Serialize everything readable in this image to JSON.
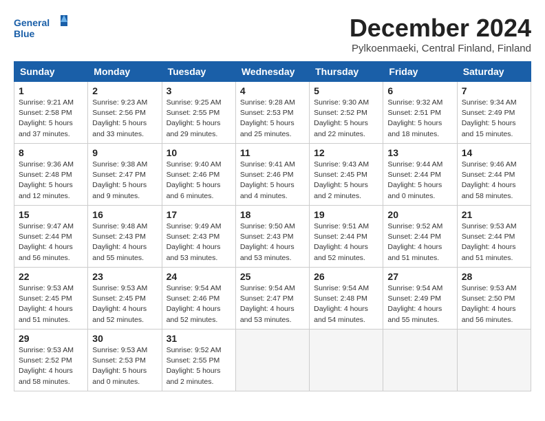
{
  "header": {
    "logo_general": "General",
    "logo_blue": "Blue",
    "month_title": "December 2024",
    "location": "Pylkoenmaeki, Central Finland, Finland"
  },
  "columns": [
    "Sunday",
    "Monday",
    "Tuesday",
    "Wednesday",
    "Thursday",
    "Friday",
    "Saturday"
  ],
  "weeks": [
    [
      {
        "day": "1",
        "sr": "9:21 AM",
        "ss": "2:58 PM",
        "dl": "5 hours and 37 minutes."
      },
      {
        "day": "2",
        "sr": "9:23 AM",
        "ss": "2:56 PM",
        "dl": "5 hours and 33 minutes."
      },
      {
        "day": "3",
        "sr": "9:25 AM",
        "ss": "2:55 PM",
        "dl": "5 hours and 29 minutes."
      },
      {
        "day": "4",
        "sr": "9:28 AM",
        "ss": "2:53 PM",
        "dl": "5 hours and 25 minutes."
      },
      {
        "day": "5",
        "sr": "9:30 AM",
        "ss": "2:52 PM",
        "dl": "5 hours and 22 minutes."
      },
      {
        "day": "6",
        "sr": "9:32 AM",
        "ss": "2:51 PM",
        "dl": "5 hours and 18 minutes."
      },
      {
        "day": "7",
        "sr": "9:34 AM",
        "ss": "2:49 PM",
        "dl": "5 hours and 15 minutes."
      }
    ],
    [
      {
        "day": "8",
        "sr": "9:36 AM",
        "ss": "2:48 PM",
        "dl": "5 hours and 12 minutes."
      },
      {
        "day": "9",
        "sr": "9:38 AM",
        "ss": "2:47 PM",
        "dl": "5 hours and 9 minutes."
      },
      {
        "day": "10",
        "sr": "9:40 AM",
        "ss": "2:46 PM",
        "dl": "5 hours and 6 minutes."
      },
      {
        "day": "11",
        "sr": "9:41 AM",
        "ss": "2:46 PM",
        "dl": "5 hours and 4 minutes."
      },
      {
        "day": "12",
        "sr": "9:43 AM",
        "ss": "2:45 PM",
        "dl": "5 hours and 2 minutes."
      },
      {
        "day": "13",
        "sr": "9:44 AM",
        "ss": "2:44 PM",
        "dl": "5 hours and 0 minutes."
      },
      {
        "day": "14",
        "sr": "9:46 AM",
        "ss": "2:44 PM",
        "dl": "4 hours and 58 minutes."
      }
    ],
    [
      {
        "day": "15",
        "sr": "9:47 AM",
        "ss": "2:44 PM",
        "dl": "4 hours and 56 minutes."
      },
      {
        "day": "16",
        "sr": "9:48 AM",
        "ss": "2:43 PM",
        "dl": "4 hours and 55 minutes."
      },
      {
        "day": "17",
        "sr": "9:49 AM",
        "ss": "2:43 PM",
        "dl": "4 hours and 53 minutes."
      },
      {
        "day": "18",
        "sr": "9:50 AM",
        "ss": "2:43 PM",
        "dl": "4 hours and 53 minutes."
      },
      {
        "day": "19",
        "sr": "9:51 AM",
        "ss": "2:44 PM",
        "dl": "4 hours and 52 minutes."
      },
      {
        "day": "20",
        "sr": "9:52 AM",
        "ss": "2:44 PM",
        "dl": "4 hours and 51 minutes."
      },
      {
        "day": "21",
        "sr": "9:53 AM",
        "ss": "2:44 PM",
        "dl": "4 hours and 51 minutes."
      }
    ],
    [
      {
        "day": "22",
        "sr": "9:53 AM",
        "ss": "2:45 PM",
        "dl": "4 hours and 51 minutes."
      },
      {
        "day": "23",
        "sr": "9:53 AM",
        "ss": "2:45 PM",
        "dl": "4 hours and 52 minutes."
      },
      {
        "day": "24",
        "sr": "9:54 AM",
        "ss": "2:46 PM",
        "dl": "4 hours and 52 minutes."
      },
      {
        "day": "25",
        "sr": "9:54 AM",
        "ss": "2:47 PM",
        "dl": "4 hours and 53 minutes."
      },
      {
        "day": "26",
        "sr": "9:54 AM",
        "ss": "2:48 PM",
        "dl": "4 hours and 54 minutes."
      },
      {
        "day": "27",
        "sr": "9:54 AM",
        "ss": "2:49 PM",
        "dl": "4 hours and 55 minutes."
      },
      {
        "day": "28",
        "sr": "9:53 AM",
        "ss": "2:50 PM",
        "dl": "4 hours and 56 minutes."
      }
    ],
    [
      {
        "day": "29",
        "sr": "9:53 AM",
        "ss": "2:52 PM",
        "dl": "4 hours and 58 minutes."
      },
      {
        "day": "30",
        "sr": "9:53 AM",
        "ss": "2:53 PM",
        "dl": "5 hours and 0 minutes."
      },
      {
        "day": "31",
        "sr": "9:52 AM",
        "ss": "2:55 PM",
        "dl": "5 hours and 2 minutes."
      },
      null,
      null,
      null,
      null
    ]
  ]
}
